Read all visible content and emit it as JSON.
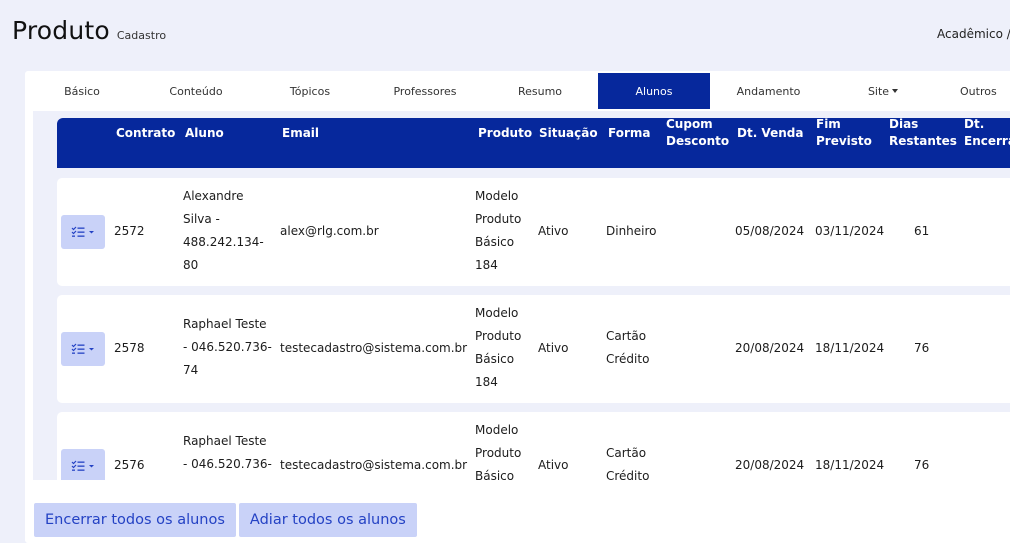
{
  "header": {
    "title": "Produto",
    "subtitle": "Cadastro",
    "top_right": "Acadêmico /"
  },
  "tabs": [
    {
      "label": "Básico"
    },
    {
      "label": "Conteúdo"
    },
    {
      "label": "Tópicos"
    },
    {
      "label": "Professores"
    },
    {
      "label": "Resumo"
    },
    {
      "label": "Alunos",
      "active": true
    },
    {
      "label": "Andamento"
    },
    {
      "label": "Site",
      "dropdown": true
    },
    {
      "label": "Outros"
    }
  ],
  "table": {
    "columns": {
      "contrato": "Contrato",
      "aluno": "Aluno",
      "email": "Email",
      "produto": "Produto",
      "situacao": "Situação",
      "forma": "Forma",
      "cupom1": "Cupom",
      "cupom2": "Desconto",
      "dtvenda": "Dt. Venda",
      "fim1": "Fim",
      "fim2": "Previsto",
      "dias1": "Dias",
      "dias2": "Restantes",
      "dtenc1": "Dt.",
      "dtenc2": "Encerramento"
    },
    "rows": [
      {
        "contrato": "2572",
        "aluno": [
          "Alexandre",
          "Silva -",
          "488.242.134-",
          "80"
        ],
        "email": "alex@rlg.com.br",
        "produto": [
          "Modelo",
          "Produto",
          "Básico",
          "184"
        ],
        "situacao": "Ativo",
        "forma": [
          "Dinheiro"
        ],
        "dt_venda": "05/08/2024",
        "fim_previsto": "03/11/2024",
        "dias_restantes": "61"
      },
      {
        "contrato": "2578",
        "aluno": [
          "Raphael Teste",
          "- 046.520.736-",
          "74"
        ],
        "email": "testecadastro@sistema.com.br",
        "produto": [
          "Modelo",
          "Produto",
          "Básico",
          "184"
        ],
        "situacao": "Ativo",
        "forma": [
          "Cartão",
          "Crédito"
        ],
        "dt_venda": "20/08/2024",
        "fim_previsto": "18/11/2024",
        "dias_restantes": "76"
      },
      {
        "contrato": "2576",
        "aluno": [
          "Raphael Teste",
          "- 046.520.736-"
        ],
        "email": "testecadastro@sistema.com.br",
        "produto": [
          "Modelo",
          "Produto",
          "Básico"
        ],
        "situacao": "Ativo",
        "forma": [
          "Cartão",
          "Crédito"
        ],
        "dt_venda": "20/08/2024",
        "fim_previsto": "18/11/2024",
        "dias_restantes": "76"
      }
    ]
  },
  "buttons": {
    "encerrar": "Encerrar todos os alunos",
    "adiar": "Adiar todos os alunos"
  },
  "colors": {
    "primary": "#06289c",
    "button_light": "#c9d2f8",
    "button_text": "#2442c4",
    "background": "#eef0fa"
  },
  "icons": {
    "row_action": "list-check-icon",
    "dropdown": "caret-down-icon"
  }
}
